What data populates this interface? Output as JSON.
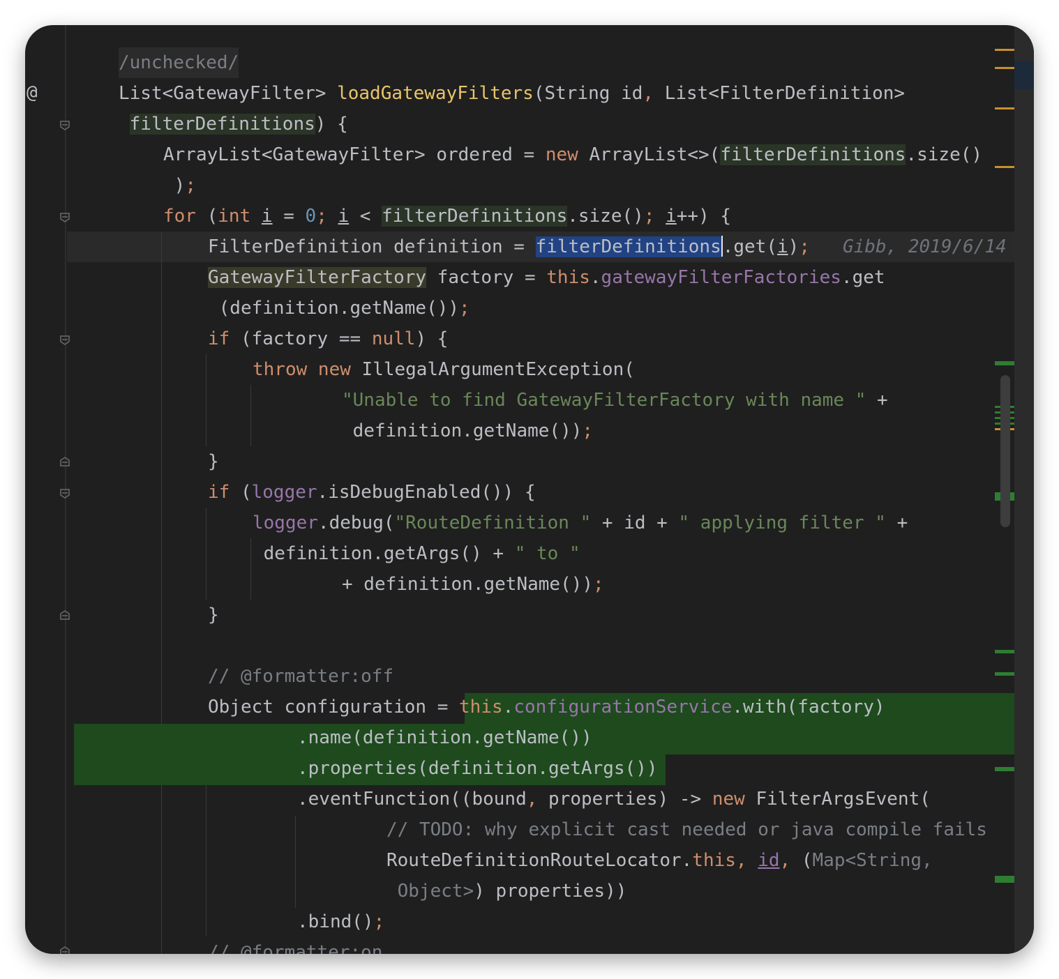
{
  "editor": {
    "gutter_at": "@",
    "lines": [
      "/unchecked/",
      "List<GatewayFilter> loadGatewayFilters(String id, List<FilterDefinition>",
      " filterDefinitions) {",
      "ArrayList<GatewayFilter> ordered = new ArrayList<>(filterDefinitions.size()",
      " );",
      "for (int i = 0; i < filterDefinitions.size(); i++) {",
      "FilterDefinition definition = filterDefinitions.get(i);",
      "GatewayFilterFactory factory = this.gatewayFilterFactories.get",
      " (definition.getName());",
      "if (factory == null) {",
      "throw new IllegalArgumentException(",
      "\"Unable to find GatewayFilterFactory with name \" +",
      " definition.getName());",
      "}",
      "if (logger.isDebugEnabled()) {",
      "logger.debug(\"RouteDefinition \" + id + \" applying filter \" +",
      " definition.getArgs() + \" to \"",
      "+ definition.getName());",
      "}",
      "// @formatter:off",
      "Object configuration = this.configurationService.with(factory)",
      ".name(definition.getName())",
      ".properties(definition.getArgs())",
      ".eventFunction((bound, properties) -> new FilterArgsEvent(",
      "// TODO: why explicit cast needed or java compile fails",
      "RouteDefinitionRouteLocator.this, id, (Map<String,",
      " Object>) properties))",
      ".bind();",
      "// @formatter:on"
    ],
    "blame_annotation": "Gibb, 2019/6/14"
  }
}
